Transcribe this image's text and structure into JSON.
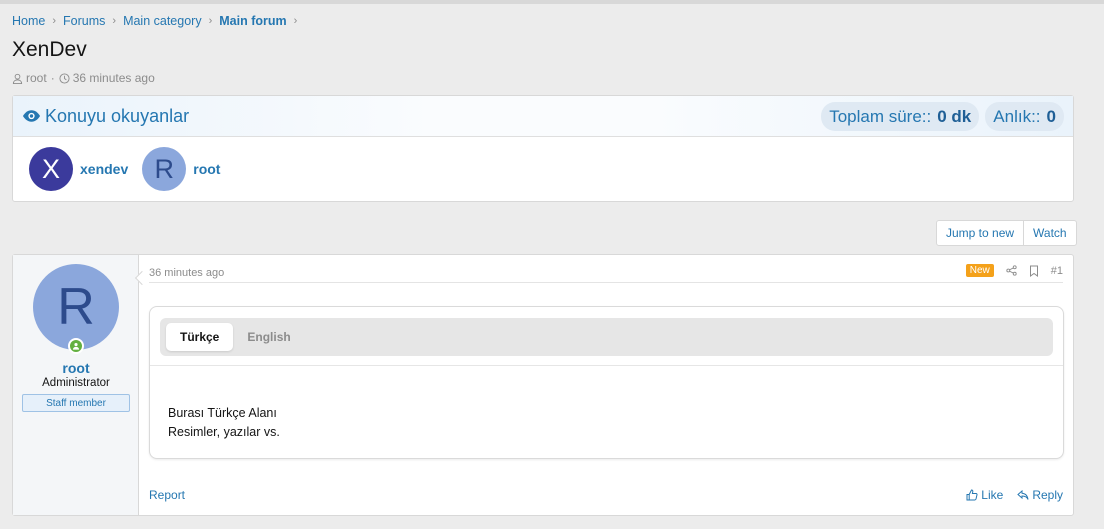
{
  "breadcrumb": {
    "items": [
      "Home",
      "Forums",
      "Main category",
      "Main forum"
    ]
  },
  "thread": {
    "title": "XenDev",
    "author": "root",
    "time": "36 minutes ago"
  },
  "readers": {
    "title": "Konuyu okuyanlar",
    "total_label": "Toplam süre::",
    "total_value": "0 dk",
    "instant_label": "Anlık::",
    "instant_value": "0",
    "users": [
      {
        "initial": "X",
        "name": "xendev",
        "color": "#3b3a9c"
      },
      {
        "initial": "R",
        "name": "root",
        "color": "#8ba7dc"
      }
    ]
  },
  "actions": {
    "jump_label": "Jump to new",
    "watch_label": "Watch"
  },
  "post": {
    "user": {
      "initial": "R",
      "name": "root",
      "title": "Administrator",
      "banner": "Staff member"
    },
    "date": "36 minutes ago",
    "badge": "New",
    "number": "#1",
    "tabs": [
      "Türkçe",
      "English"
    ],
    "content": [
      "Burası Türkçe Alanı",
      "Resimler, yazılar vs."
    ],
    "report_label": "Report",
    "like_label": "Like",
    "reply_label": "Reply"
  },
  "colors": {
    "link": "#2577b1",
    "badge_new": "#f4a11a",
    "online": "#63b040"
  }
}
